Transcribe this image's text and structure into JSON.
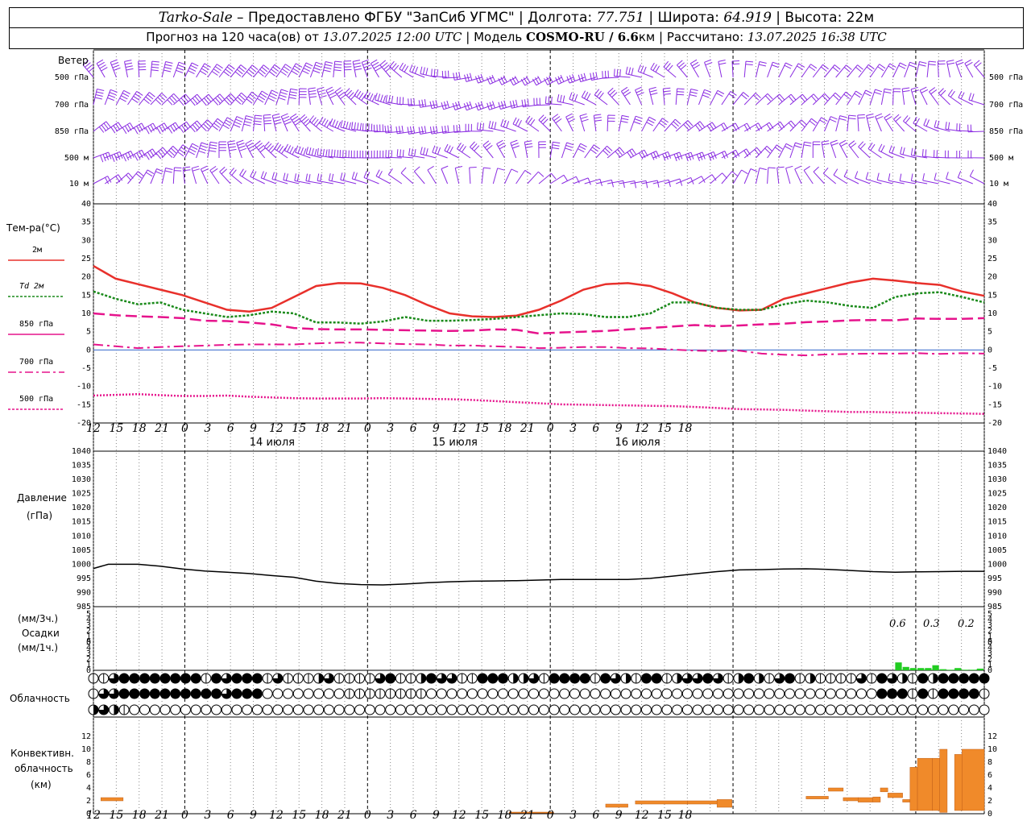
{
  "header": {
    "station": "Tarko-Sale",
    "provider": " – Предоставлено ФГБУ \"ЗапСиб УГМС\" | Долгота: ",
    "lon": "77.751",
    "lat_label": " | Широта: ",
    "lat": "64.919",
    "alt_label": " | Высота: ",
    "alt": "22м",
    "forecast_prefix": "Прогноз на 120 часа(ов) от ",
    "forecast_start": "13.07.2025 12:00 UTC",
    "model_label": " | Модель ",
    "model": "COSMO-RU / 6.6",
    "model_unit": "км | Рассчитано: ",
    "computed": "13.07.2025 16:38 UTC"
  },
  "wind": {
    "label": "Ветер",
    "levels": [
      "500 гПа",
      "700 гПа",
      "850 гПа",
      "500 м",
      "10 м"
    ],
    "color": "#8a2be2"
  },
  "temperature": {
    "label": "Тем-ра(°C)",
    "legend": [
      "2м",
      "Td  2м",
      "850 гПа",
      "700 гПа",
      "500 гПа"
    ],
    "y_ticks": [
      40,
      35,
      30,
      25,
      20,
      15,
      10,
      5,
      0,
      -5,
      -10,
      -15,
      -20
    ]
  },
  "time_axis": {
    "hour_labels": [
      "12",
      "15",
      "18",
      "21",
      "0",
      "3",
      "6",
      "9",
      "12",
      "15",
      "18",
      "21",
      "0",
      "3",
      "6",
      "9",
      "12",
      "15",
      "18",
      "21",
      "0",
      "3",
      "6",
      "9",
      "12",
      "15",
      "18"
    ],
    "day_labels": [
      "14 июля",
      "15 июля",
      "16 июля"
    ]
  },
  "pressure": {
    "label1": "Давление",
    "label2": "(гПа)",
    "y_ticks": [
      1040,
      1035,
      1030,
      1025,
      1020,
      1015,
      1010,
      1005,
      1000,
      995,
      990,
      985
    ]
  },
  "precip": {
    "label1": "(мм/3ч.)",
    "label2": "Осадки",
    "label3": "(мм/1ч.)",
    "y_ticks": [
      5,
      4,
      3,
      2,
      1,
      0,
      5,
      4,
      3,
      2,
      1,
      0
    ],
    "totals": [
      "0.6",
      "0.3",
      "0.2"
    ]
  },
  "cloud": {
    "label": "Облачность",
    "rows": [
      "1134444444414344413111231111341124331144422314444143214412334312421341211113143214244444",
      "1334444444444344400000000111111110000000000000000000000000000000000000000000044414144441",
      "2321000000000000000000000000000000000000000000000000000000000000000000000000000000000000"
    ]
  },
  "convective": {
    "label1": "Конвективн.",
    "label2": "облачность",
    "label3": "(км)",
    "y_ticks": [
      12,
      10,
      8,
      6,
      4,
      2,
      0
    ]
  },
  "chart_data": [
    {
      "type": "line",
      "title": "Тем-ра(°C)",
      "x_hours": [
        0,
        3,
        6,
        9,
        12,
        15,
        18,
        21,
        24,
        27,
        30,
        33,
        36,
        39,
        42,
        45,
        48,
        51,
        54,
        57,
        60,
        63,
        66,
        69,
        72,
        75,
        78,
        81,
        84,
        87,
        90,
        93,
        96,
        99,
        102,
        105,
        108,
        111,
        114,
        117,
        120
      ],
      "ylim": [
        -20,
        40
      ],
      "series": [
        {
          "name": "2м",
          "color": "#e8302b",
          "values": [
            23,
            19.5,
            18,
            16.5,
            15,
            13,
            11,
            10.5,
            11.5,
            14.5,
            17.5,
            18.3,
            18.2,
            17,
            15,
            12.3,
            10,
            9.2,
            9,
            9.4,
            11,
            13.5,
            16.5,
            18,
            18.3,
            17.5,
            15.5,
            13,
            11.5,
            10.8,
            11,
            14,
            15.5,
            17,
            18.5,
            19.5,
            19,
            18.3,
            17.8,
            16,
            14.8
          ]
        },
        {
          "name": "Td  2м",
          "color": "#1a8a1a",
          "values": [
            16,
            14,
            12.5,
            13,
            11,
            10,
            9,
            9.5,
            10.5,
            10,
            7.5,
            7.5,
            7.2,
            7.8,
            9,
            8,
            8,
            8.2,
            8.5,
            9,
            9.5,
            10,
            9.8,
            9,
            9,
            10,
            13,
            13,
            11.5,
            11,
            11,
            12.5,
            13.5,
            13,
            12,
            11.5,
            14.5,
            15.5,
            15.8,
            14.5,
            13
          ]
        },
        {
          "name": "850 гПа",
          "color": "#e6138c",
          "values": [
            10,
            9.5,
            9.2,
            9,
            8.7,
            8,
            7.9,
            7.5,
            7,
            6,
            5.7,
            5.6,
            5.6,
            5.5,
            5.4,
            5.3,
            5.2,
            5.3,
            5.6,
            5.5,
            4.5,
            4.8,
            5,
            5.2,
            5.6,
            6,
            6.4,
            6.8,
            6.5,
            6.7,
            7,
            7.2,
            7.6,
            7.8,
            8.1,
            8.2,
            8.1,
            8.6,
            8.5,
            8.5,
            8.7
          ]
        },
        {
          "name": "700 гПа",
          "color": "#e6138c",
          "values": [
            1.5,
            1,
            0.5,
            0.8,
            1,
            1.2,
            1.4,
            1.5,
            1.5,
            1.5,
            1.8,
            2,
            2,
            1.8,
            1.6,
            1.5,
            1.2,
            1.2,
            1,
            0.8,
            0.5,
            0.6,
            0.8,
            0.8,
            0.5,
            0.4,
            0.1,
            -0.2,
            -0.3,
            -0.2,
            -1,
            -1.3,
            -1.5,
            -1.2,
            -1.1,
            -1,
            -1,
            -0.9,
            -1.1,
            -0.9,
            -1
          ]
        },
        {
          "name": "500 гПа",
          "color": "#e6138c",
          "values": [
            -12.5,
            -12.3,
            -12.1,
            -12.4,
            -12.6,
            -12.6,
            -12.5,
            -12.8,
            -13,
            -13.2,
            -13.3,
            -13.3,
            -13.3,
            -13.2,
            -13.3,
            -13.4,
            -13.5,
            -13.7,
            -14,
            -14.3,
            -14.6,
            -14.9,
            -15,
            -15.1,
            -15.2,
            -15.3,
            -15.4,
            -15.6,
            -15.9,
            -16.2,
            -16.3,
            -16.4,
            -16.6,
            -16.8,
            -17,
            -17,
            -17.1,
            -17.2,
            -17.3,
            -17.4,
            -17.5
          ]
        }
      ]
    },
    {
      "type": "line",
      "title": "Давление",
      "ylim": [
        985,
        1040
      ],
      "x_hours": [
        0,
        2,
        4,
        6,
        9,
        12,
        15,
        18,
        21,
        24,
        27,
        30,
        33,
        36,
        39,
        42,
        45,
        48,
        51,
        54,
        57,
        60,
        63,
        66,
        69,
        72,
        75,
        78,
        81,
        84,
        87,
        90,
        93,
        96,
        99,
        102,
        105,
        108,
        111,
        114,
        117,
        120
      ],
      "series": [
        {
          "name": "Давление",
          "color": "#000000",
          "values": [
            998.5,
            1000,
            1000,
            1000,
            999.3,
            998.3,
            997.6,
            997.2,
            996.7,
            996,
            995.4,
            994,
            993.2,
            992.8,
            992.7,
            993,
            993.5,
            993.8,
            994,
            994.1,
            994.2,
            994.4,
            994.6,
            994.6,
            994.6,
            994.6,
            995,
            995.8,
            996.6,
            997.4,
            998,
            998.1,
            998.3,
            998.4,
            998.2,
            997.8,
            997.4,
            997.2,
            997.3,
            997.4,
            997.5,
            997.5
          ]
        }
      ]
    },
    {
      "type": "bar",
      "title": "Осадки",
      "ylim": [
        0,
        5
      ],
      "x_hours": [
        109,
        110,
        111,
        112,
        113,
        114,
        115,
        116,
        117,
        118,
        119,
        120
      ],
      "values": [
        0.7,
        0.3,
        0.2,
        0.2,
        0.2,
        0.45,
        0.1,
        0.05,
        0.2,
        0.05,
        0.05,
        0.15
      ]
    },
    {
      "type": "bar",
      "title": "Конвективн. облачность",
      "ylim": [
        0,
        13
      ],
      "segments": [
        {
          "x": [
            1,
            4
          ],
          "lo": 2,
          "hi": 2.5
        },
        {
          "x": [
            56,
            62
          ],
          "lo": 0.1,
          "hi": 0.25
        },
        {
          "x": [
            69,
            72
          ],
          "lo": 1,
          "hi": 1.5
        },
        {
          "x": [
            73,
            80
          ],
          "lo": 1.5,
          "hi": 2
        },
        {
          "x": [
            80,
            84
          ],
          "lo": 1.5,
          "hi": 2
        },
        {
          "x": [
            84,
            86
          ],
          "lo": 1,
          "hi": 2.2
        },
        {
          "x": [
            96,
            99
          ],
          "lo": 2.3,
          "hi": 2.7
        },
        {
          "x": [
            99,
            101
          ],
          "lo": 3.5,
          "hi": 4
        },
        {
          "x": [
            101,
            103
          ],
          "lo": 2,
          "hi": 2.5
        },
        {
          "x": [
            103,
            105
          ],
          "lo": 1.8,
          "hi": 2.5
        },
        {
          "x": [
            105,
            106
          ],
          "lo": 1.8,
          "hi": 2.6
        },
        {
          "x": [
            106,
            107
          ],
          "lo": 3.4,
          "hi": 4
        },
        {
          "x": [
            107,
            109
          ],
          "lo": 2.5,
          "hi": 3.2
        },
        {
          "x": [
            109,
            110
          ],
          "lo": 1.8,
          "hi": 2.2
        },
        {
          "x": [
            110,
            111
          ],
          "lo": 0.5,
          "hi": 7.2
        },
        {
          "x": [
            111,
            113
          ],
          "lo": 0.5,
          "hi": 8.6
        },
        {
          "x": [
            113,
            114
          ],
          "lo": 0.5,
          "hi": 8.6
        },
        {
          "x": [
            114,
            115
          ],
          "lo": 0.2,
          "hi": 10
        },
        {
          "x": [
            116,
            117
          ],
          "lo": 0.5,
          "hi": 9.2
        },
        {
          "x": [
            117,
            120
          ],
          "lo": 0.5,
          "hi": 10
        }
      ]
    }
  ]
}
